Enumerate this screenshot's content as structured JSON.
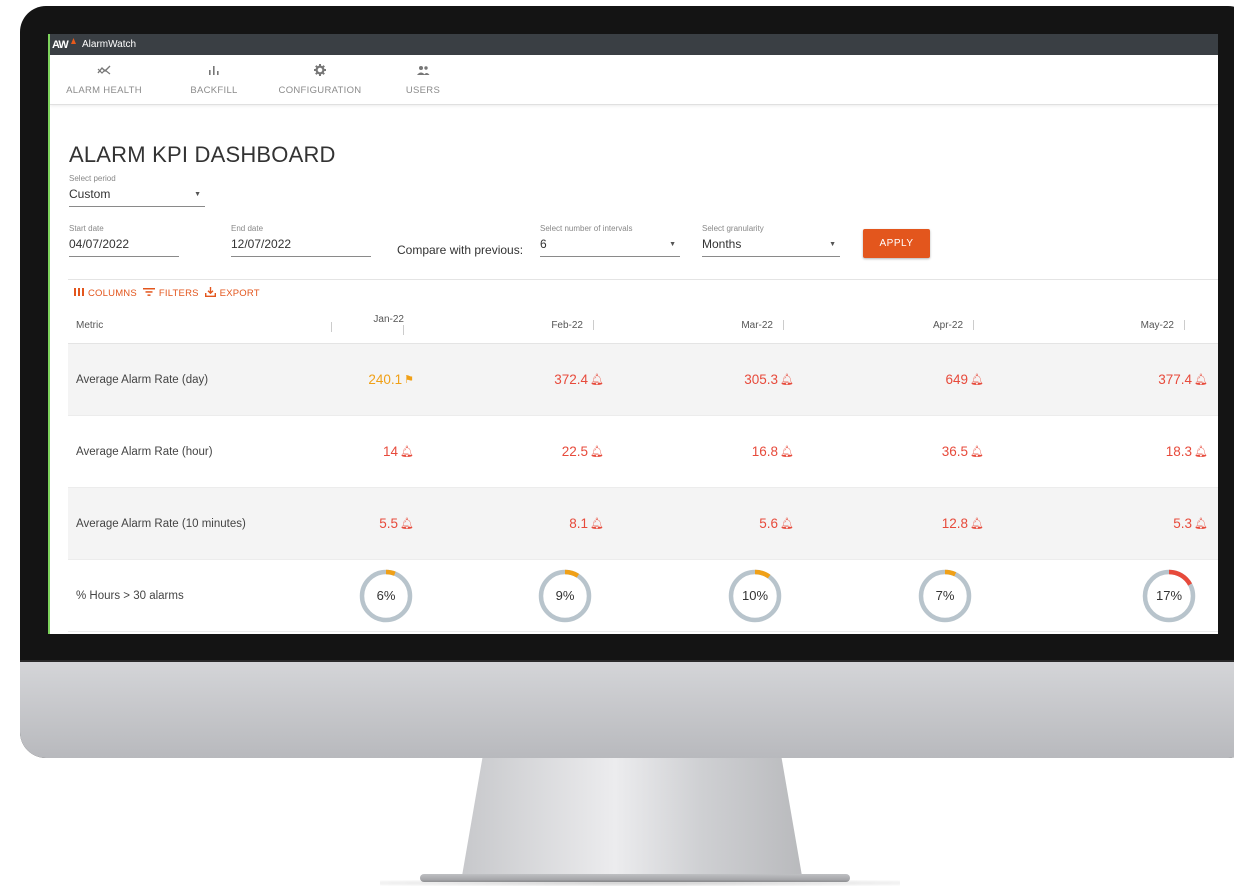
{
  "app": {
    "logo_text": "AW",
    "title": "AlarmWatch"
  },
  "nav": [
    {
      "label": "ALARM HEALTH",
      "icon": "trending-icon",
      "glyph": "〜"
    },
    {
      "label": "BACKFILL",
      "icon": "bar-chart-icon",
      "glyph": "ıl"
    },
    {
      "label": "CONFIGURATION",
      "icon": "gear-icon",
      "glyph": "✿"
    },
    {
      "label": "USERS",
      "icon": "people-icon",
      "glyph": "👥"
    }
  ],
  "page": {
    "title": "ALARM KPI DASHBOARD"
  },
  "filters": {
    "period_label": "Select period",
    "period_value": "Custom",
    "start_label": "Start date",
    "start_value": "04/07/2022",
    "end_label": "End date",
    "end_value": "12/07/2022",
    "compare_label": "Compare with previous:",
    "intervals_label": "Select number of intervals",
    "intervals_value": "6",
    "granularity_label": "Select granularity",
    "granularity_value": "Months",
    "apply_label": "APPLY"
  },
  "toolbar": {
    "columns": "COLUMNS",
    "filters": "FILTERS",
    "export": "EXPORT"
  },
  "table": {
    "metric_header": "Metric",
    "columns": [
      "Jan-22",
      "Feb-22",
      "Mar-22",
      "Apr-22",
      "May-22"
    ],
    "rows": [
      {
        "label": "Average Alarm Rate (day)",
        "values": [
          "240.1",
          "372.4",
          "305.3",
          "649",
          "377.4"
        ],
        "status": [
          "warn",
          "alarm",
          "alarm",
          "alarm",
          "alarm"
        ]
      },
      {
        "label": "Average Alarm Rate (hour)",
        "values": [
          "14",
          "22.5",
          "16.8",
          "36.5",
          "18.3"
        ],
        "status": [
          "alarm",
          "alarm",
          "alarm",
          "alarm",
          "alarm"
        ]
      },
      {
        "label": "Average Alarm Rate (10 minutes)",
        "values": [
          "5.5",
          "8.1",
          "5.6",
          "12.8",
          "5.3"
        ],
        "status": [
          "alarm",
          "alarm",
          "alarm",
          "alarm",
          "alarm"
        ]
      }
    ],
    "pct_row": {
      "label": "% Hours > 30 alarms",
      "values": [
        "6%",
        "9%",
        "10%",
        "7%",
        "17%"
      ],
      "fractions": [
        0.06,
        0.09,
        0.1,
        0.07,
        0.17
      ]
    }
  },
  "colors": {
    "accent": "#e3561d",
    "alarm": "#e74a3b",
    "warn": "#f0a017",
    "donut_track": "#b8c4cc",
    "donut_high": "#e74a3b"
  }
}
